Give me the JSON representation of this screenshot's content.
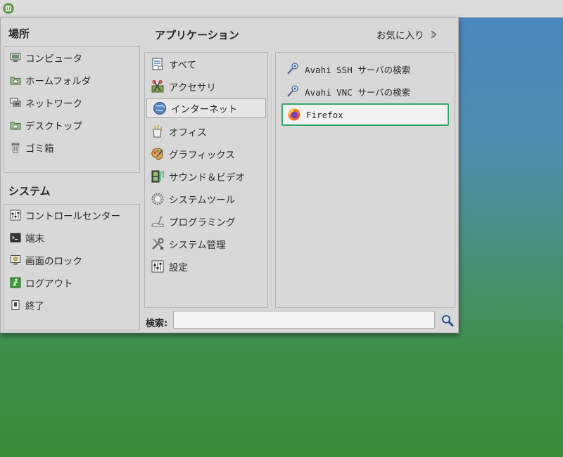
{
  "places": {
    "title": "場所",
    "items": [
      {
        "label": "コンピュータ",
        "icon": "computer-icon"
      },
      {
        "label": "ホームフォルダ",
        "icon": "home-folder-icon"
      },
      {
        "label": "ネットワーク",
        "icon": "network-icon"
      },
      {
        "label": "デスクトップ",
        "icon": "desktop-folder-icon"
      },
      {
        "label": "ゴミ箱",
        "icon": "trash-icon"
      }
    ]
  },
  "system": {
    "title": "システム",
    "items": [
      {
        "label": "コントロールセンター",
        "icon": "control-center-icon"
      },
      {
        "label": "端末",
        "icon": "terminal-icon"
      },
      {
        "label": "画面のロック",
        "icon": "lock-screen-icon"
      },
      {
        "label": "ログアウト",
        "icon": "logout-icon"
      },
      {
        "label": "終了",
        "icon": "shutdown-icon"
      }
    ]
  },
  "applications": {
    "title": "アプリケーション",
    "favorites_label": "お気に入り",
    "categories": [
      {
        "label": "すべて",
        "icon": "all-apps-icon"
      },
      {
        "label": "アクセサリ",
        "icon": "accessories-icon"
      },
      {
        "label": "インターネット",
        "icon": "internet-globe-icon",
        "selected": true
      },
      {
        "label": "オフィス",
        "icon": "office-icon"
      },
      {
        "label": "グラフィックス",
        "icon": "graphics-palette-icon"
      },
      {
        "label": "サウンド＆ビデオ",
        "icon": "sound-video-icon"
      },
      {
        "label": "システムツール",
        "icon": "system-tools-gear-icon"
      },
      {
        "label": "プログラミング",
        "icon": "programming-icon"
      },
      {
        "label": "システム管理",
        "icon": "system-admin-tools-icon"
      },
      {
        "label": "設定",
        "icon": "settings-icon"
      }
    ],
    "apps": [
      {
        "label": "Avahi SSH サーバの検索",
        "icon": "avahi-ssh-icon"
      },
      {
        "label": "Avahi VNC サーバの検索",
        "icon": "avahi-vnc-icon"
      },
      {
        "label": "Firefox",
        "icon": "firefox-icon",
        "highlighted": true
      }
    ]
  },
  "search": {
    "label": "検索:",
    "value": "",
    "placeholder": ""
  },
  "colors": {
    "menu_bg": "#d8d8d8",
    "highlight_border": "#3aa572",
    "search_icon": "#2b4c8c"
  }
}
